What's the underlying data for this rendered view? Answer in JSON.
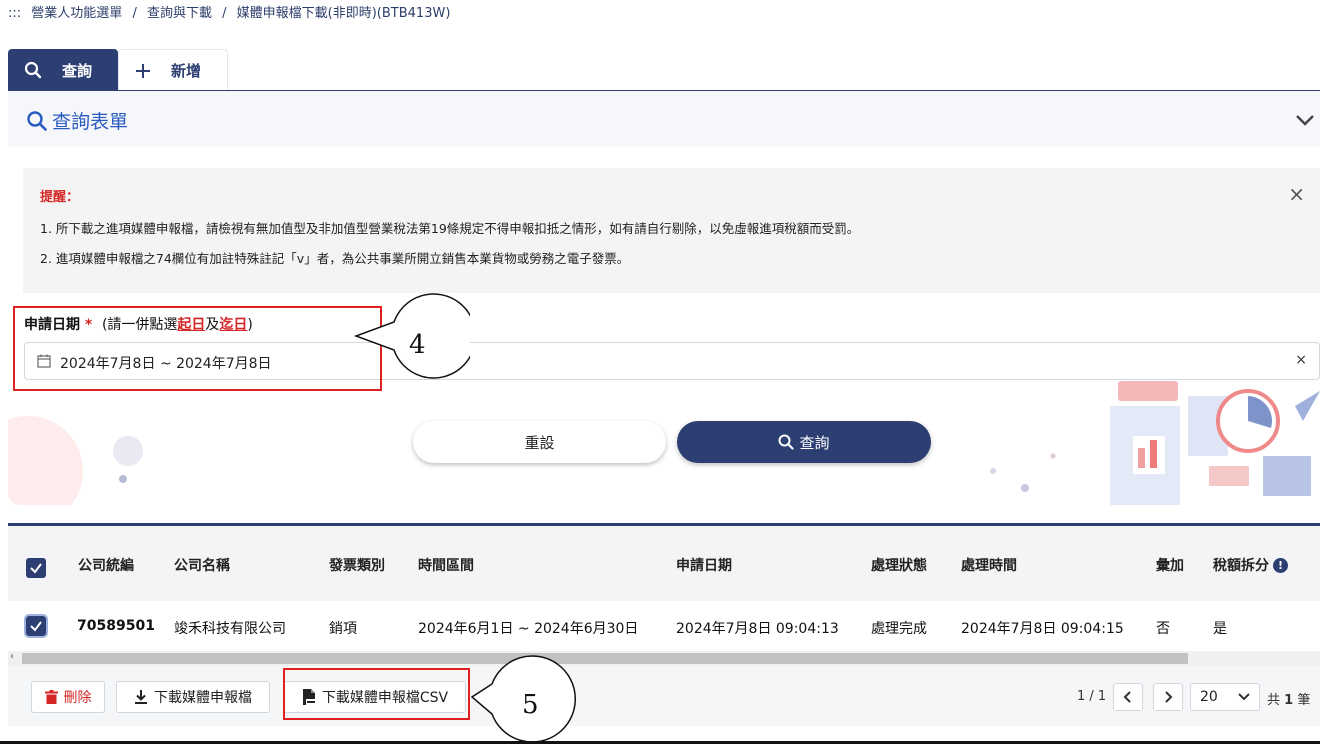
{
  "breadcrumb": {
    "prefix": ":::",
    "items": [
      "營業人功能選單",
      "查詢與下載",
      "媒體申報檔下載(非即時)(BTB413W)"
    ],
    "separator": "/"
  },
  "tabs": [
    {
      "label": "查詢",
      "icon": "search-icon"
    },
    {
      "label": "新增",
      "icon": "plus-icon"
    }
  ],
  "form": {
    "title": "查詢表單",
    "notice": {
      "title": "提醒：",
      "lines": [
        "1. 所下載之進項媒體申報檔，請檢視有無加值型及非加值型營業稅法第19條規定不得申報扣抵之情形，如有請自行剔除，以免虛報進項稅額而受罰。",
        "2. 進項媒體申報檔之74欄位有加註特殊註記「v」者，為公共事業所開立銷售本業貨物或勞務之電子發票。"
      ],
      "close": "×"
    },
    "date_label": "申請日期",
    "required_mark": "*",
    "hint_open": "(請一併點選",
    "hint_start": "起日",
    "hint_mid": "及",
    "hint_end": "迄日",
    "hint_close": ")",
    "date_value": "2024年7月8日 ~ 2024年7月8日",
    "date_clear": "×",
    "reset_label": "重設",
    "query_label": "查詢"
  },
  "annotations": [
    "4",
    "5"
  ],
  "table": {
    "columns": [
      "公司統編",
      "公司名稱",
      "發票類別",
      "時間區間",
      "申請日期",
      "處理狀態",
      "處理時間",
      "彙加",
      "稅額拆分"
    ],
    "info_glyph": "!",
    "rows": [
      [
        "70589501",
        "竣禾科技有限公司",
        "銷項",
        "2024年6月1日 ~ 2024年6月30日",
        "2024年7月8日 09:04:13",
        "處理完成",
        "2024年7月8日 09:04:15",
        "否",
        "是"
      ]
    ],
    "scroll_left": "‹"
  },
  "footer": {
    "delete_label": "刪除",
    "download_label": "下載媒體申報檔",
    "download_csv_label": "下載媒體申報檔CSV",
    "page_info": "1 / 1",
    "page_size": "20",
    "total_prefix": "共",
    "total_count": "1",
    "total_suffix": "筆"
  },
  "colors": {
    "primary": "#2d3f72",
    "title_blue": "#2a5bbf",
    "alert_red": "#d52626",
    "annotation_red": "#e02020"
  }
}
